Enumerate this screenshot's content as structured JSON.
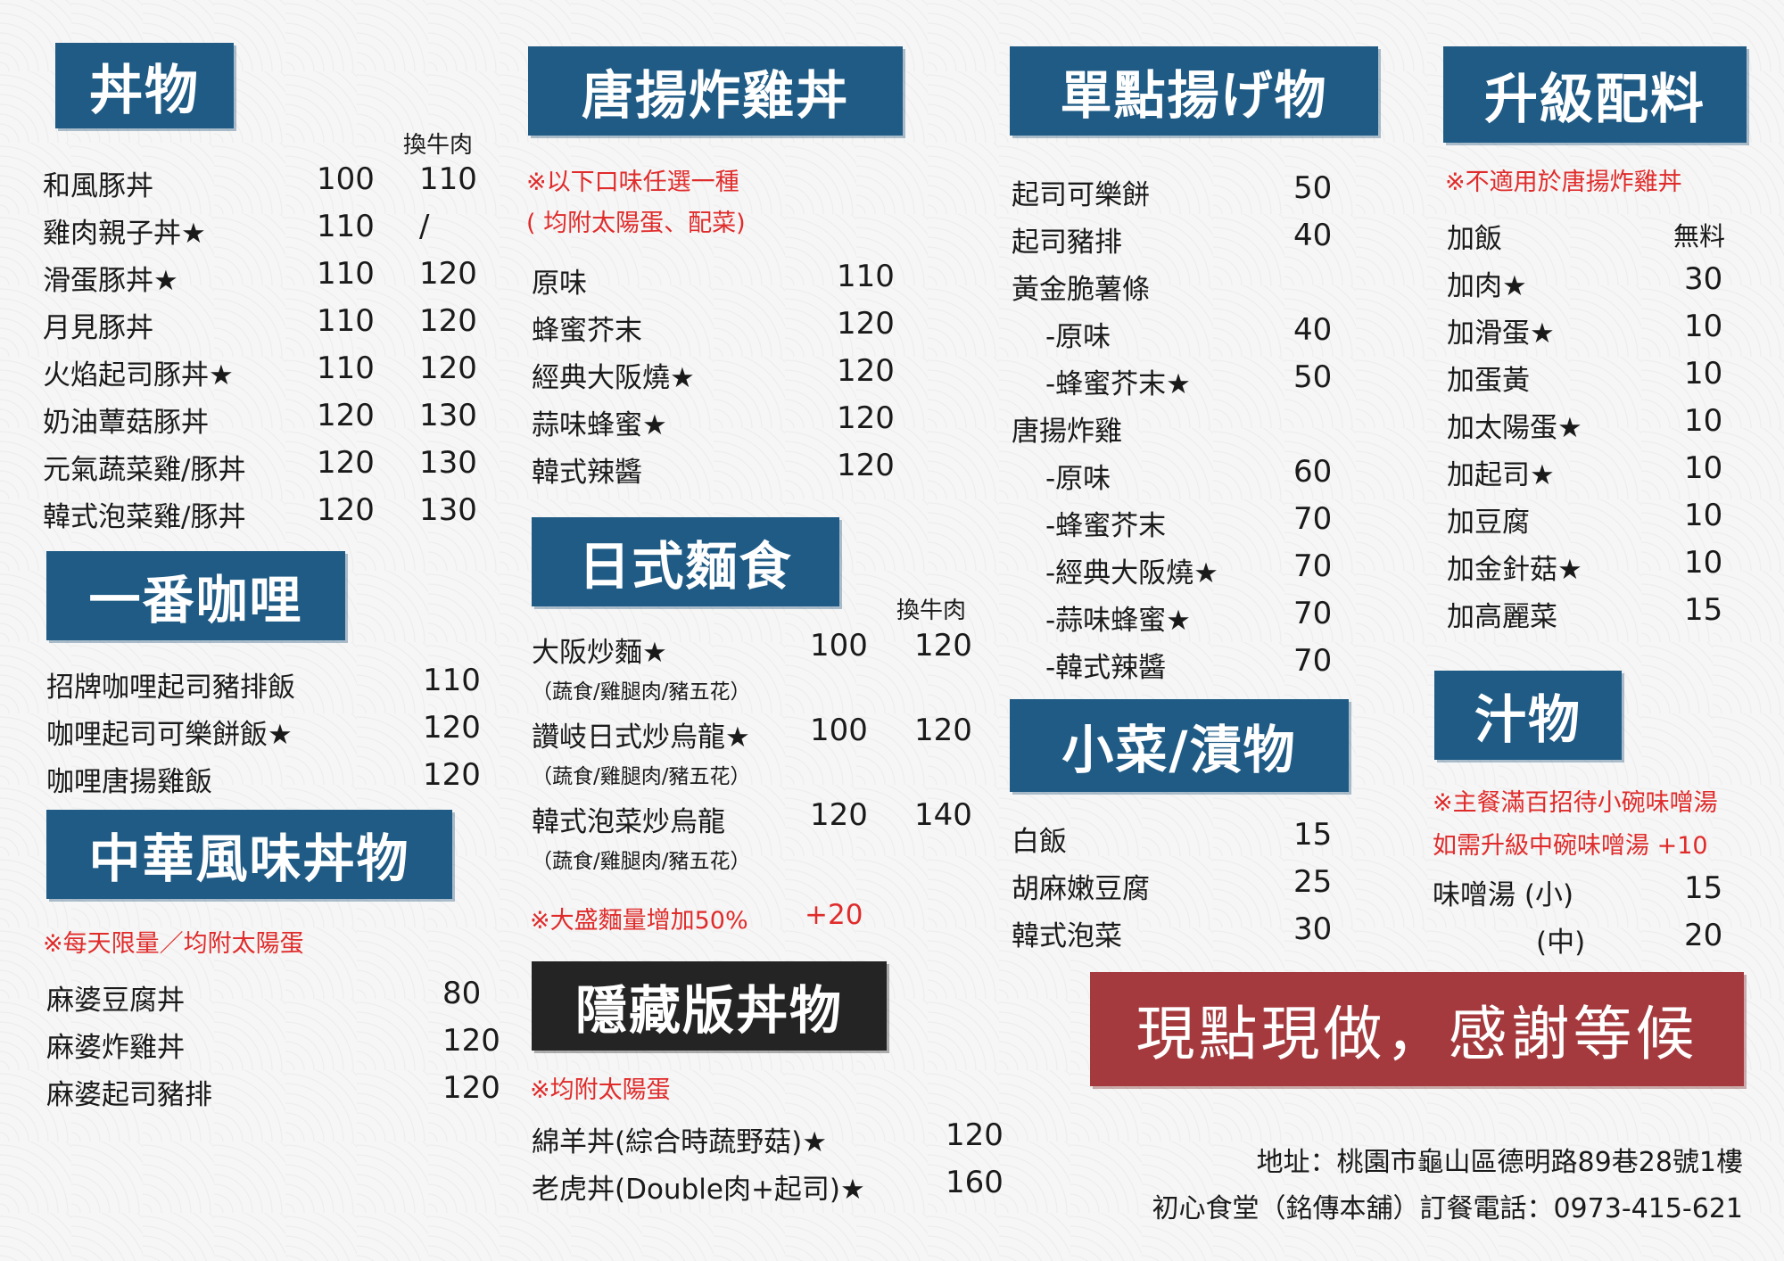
{
  "donburi": {
    "title": "丼物",
    "col_header": "換牛肉",
    "items": [
      {
        "name": "和風豚丼",
        "price": "100",
        "beef": "110"
      },
      {
        "name": "雞肉親子丼★",
        "price": "110",
        "beef": "/"
      },
      {
        "name": "滑蛋豚丼★",
        "price": "110",
        "beef": "120"
      },
      {
        "name": "月見豚丼",
        "price": "110",
        "beef": "120"
      },
      {
        "name": "火焰起司豚丼★",
        "price": "110",
        "beef": "120"
      },
      {
        "name": "奶油蕈菇豚丼",
        "price": "120",
        "beef": "130"
      },
      {
        "name": "元氣蔬菜雞/豚丼",
        "price": "120",
        "beef": "130"
      },
      {
        "name": "韓式泡菜雞/豚丼",
        "price": "120",
        "beef": "130"
      }
    ]
  },
  "curry": {
    "title": "一番咖哩",
    "items": [
      {
        "name": "招牌咖哩起司豬排飯",
        "price": "110"
      },
      {
        "name": "咖哩起司可樂餅飯★",
        "price": "120"
      },
      {
        "name": "咖哩唐揚雞飯",
        "price": "120"
      }
    ]
  },
  "chinese": {
    "title": "中華風味丼物",
    "note": "※每天限量／均附太陽蛋",
    "items": [
      {
        "name": "麻婆豆腐丼",
        "price": "80"
      },
      {
        "name": "麻婆炸雞丼",
        "price": "120"
      },
      {
        "name": "麻婆起司豬排",
        "price": "120"
      }
    ]
  },
  "karaage": {
    "title": "唐揚炸雞丼",
    "note1": "※以下口味任選一種",
    "note2": "( 均附太陽蛋、配菜)",
    "items": [
      {
        "name": "原味",
        "price": "110"
      },
      {
        "name": "蜂蜜芥末",
        "price": "120"
      },
      {
        "name": "經典大阪燒★",
        "price": "120"
      },
      {
        "name": "蒜味蜂蜜★",
        "price": "120"
      },
      {
        "name": "韓式辣醬",
        "price": "120"
      }
    ]
  },
  "noodles": {
    "title": "日式麵食",
    "col_header": "換牛肉",
    "items": [
      {
        "name": "大阪炒麵★",
        "price": "100",
        "beef": "120",
        "sub": "（蔬食/雞腿肉/豬五花）"
      },
      {
        "name": "讚岐日式炒烏龍★",
        "price": "100",
        "beef": "120",
        "sub": "（蔬食/雞腿肉/豬五花）"
      },
      {
        "name": "韓式泡菜炒烏龍",
        "price": "120",
        "beef": "140",
        "sub": "（蔬食/雞腿肉/豬五花）"
      }
    ],
    "note": "※大盛麵量增加50%",
    "note_price": "+20"
  },
  "hidden": {
    "title": "隱藏版丼物",
    "note": "※均附太陽蛋",
    "items": [
      {
        "name": "綿羊丼(綜合時蔬野菇)★",
        "price": "120"
      },
      {
        "name": "老虎丼(Double肉+起司)★",
        "price": "160"
      }
    ]
  },
  "fried": {
    "title": "單點揚げ物",
    "items": [
      {
        "name": "起司可樂餅",
        "price": "50"
      },
      {
        "name": "起司豬排",
        "price": "40"
      },
      {
        "name": "黃金脆薯條",
        "price": ""
      },
      {
        "name": "-原味",
        "price": "40"
      },
      {
        "name": "-蜂蜜芥末★",
        "price": "50"
      },
      {
        "name": "唐揚炸雞",
        "price": ""
      },
      {
        "name": "-原味",
        "price": "60"
      },
      {
        "name": "-蜂蜜芥末",
        "price": "70"
      },
      {
        "name": "-經典大阪燒★",
        "price": "70"
      },
      {
        "name": "-蒜味蜂蜜★",
        "price": "70"
      },
      {
        "name": "-韓式辣醬",
        "price": "70"
      }
    ]
  },
  "sides": {
    "title": "小菜/漬物",
    "items": [
      {
        "name": "白飯",
        "price": "15"
      },
      {
        "name": "胡麻嫩豆腐",
        "price": "25"
      },
      {
        "name": "韓式泡菜",
        "price": "30"
      }
    ]
  },
  "upgrade": {
    "title": "升級配料",
    "note": "※不適用於唐揚炸雞丼",
    "items": [
      {
        "name": "加飯",
        "price": "無料"
      },
      {
        "name": "加肉★",
        "price": "30"
      },
      {
        "name": "加滑蛋★",
        "price": "10"
      },
      {
        "name": "加蛋黃",
        "price": "10"
      },
      {
        "name": "加太陽蛋★",
        "price": "10"
      },
      {
        "name": "加起司★",
        "price": "10"
      },
      {
        "name": "加豆腐",
        "price": "10"
      },
      {
        "name": "加金針菇★",
        "price": "10"
      },
      {
        "name": "加高麗菜",
        "price": "15"
      }
    ]
  },
  "soup": {
    "title": "汁物",
    "note1": "※主餐滿百招待小碗味噌湯",
    "note2": "如需升級中碗味噌湯 +10",
    "items": [
      {
        "name": "味噌湯 (小)",
        "price": "15"
      },
      {
        "name": "(中)",
        "price": "20"
      }
    ]
  },
  "slogan": "現點現做，感謝等候",
  "footer": {
    "address": "地址：桃園市龜山區德明路89巷28號1樓",
    "phone": "初心食堂（銘傳本舖）訂餐電話：0973-415-621"
  },
  "colors": {
    "banner_blue": "#1f5b85",
    "banner_dark": "#242424",
    "banner_red": "#a53a3e",
    "note_red": "#e02b2b"
  }
}
